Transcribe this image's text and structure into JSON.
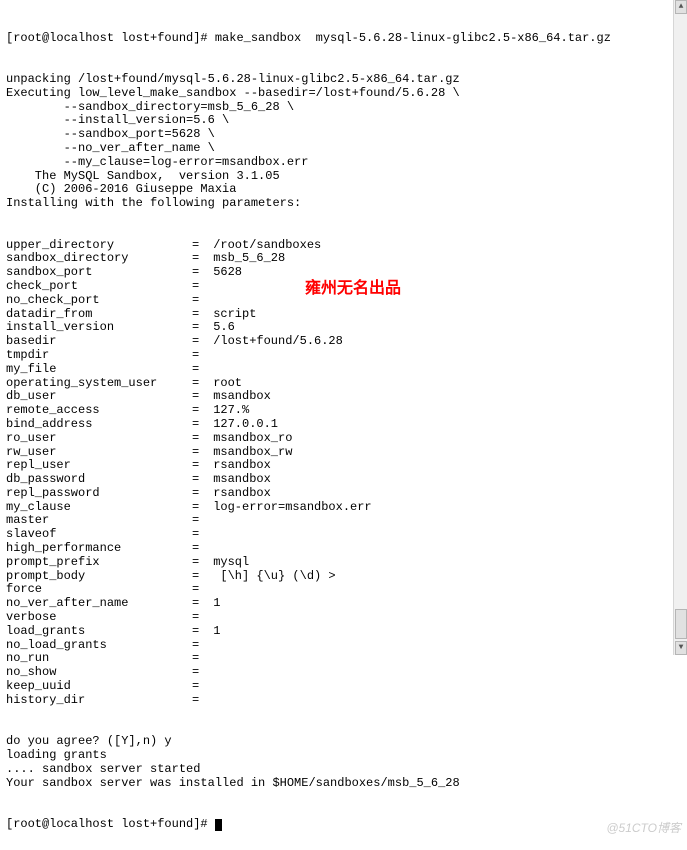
{
  "prompt1": "[root@localhost lost+found]# make_sandbox  mysql-5.6.28-linux-glibc2.5-x86_64.tar.gz",
  "header": [
    "unpacking /lost+found/mysql-5.6.28-linux-glibc2.5-x86_64.tar.gz",
    "Executing low_level_make_sandbox --basedir=/lost+found/5.6.28 \\",
    "        --sandbox_directory=msb_5_6_28 \\",
    "        --install_version=5.6 \\",
    "        --sandbox_port=5628 \\",
    "        --no_ver_after_name \\",
    "        --my_clause=log-error=msandbox.err",
    "    The MySQL Sandbox,  version 3.1.05",
    "    (C) 2006-2016 Giuseppe Maxia",
    "Installing with the following parameters:"
  ],
  "params": [
    {
      "k": "upper_directory",
      "v": "/root/sandboxes"
    },
    {
      "k": "sandbox_directory",
      "v": "msb_5_6_28"
    },
    {
      "k": "sandbox_port",
      "v": "5628"
    },
    {
      "k": "check_port",
      "v": ""
    },
    {
      "k": "no_check_port",
      "v": ""
    },
    {
      "k": "datadir_from",
      "v": "script"
    },
    {
      "k": "install_version",
      "v": "5.6"
    },
    {
      "k": "basedir",
      "v": "/lost+found/5.6.28"
    },
    {
      "k": "tmpdir",
      "v": ""
    },
    {
      "k": "my_file",
      "v": ""
    },
    {
      "k": "operating_system_user",
      "v": "root"
    },
    {
      "k": "db_user",
      "v": "msandbox"
    },
    {
      "k": "remote_access",
      "v": "127.%"
    },
    {
      "k": "bind_address",
      "v": "127.0.0.1"
    },
    {
      "k": "ro_user",
      "v": "msandbox_ro"
    },
    {
      "k": "rw_user",
      "v": "msandbox_rw"
    },
    {
      "k": "repl_user",
      "v": "rsandbox"
    },
    {
      "k": "db_password",
      "v": "msandbox"
    },
    {
      "k": "repl_password",
      "v": "rsandbox"
    },
    {
      "k": "my_clause",
      "v": "log-error=msandbox.err"
    },
    {
      "k": "master",
      "v": ""
    },
    {
      "k": "slaveof",
      "v": ""
    },
    {
      "k": "high_performance",
      "v": ""
    },
    {
      "k": "prompt_prefix",
      "v": "mysql"
    },
    {
      "k": "prompt_body",
      "v": " [\\h] {\\u} (\\d) >"
    },
    {
      "k": "force",
      "v": ""
    },
    {
      "k": "no_ver_after_name",
      "v": "1"
    },
    {
      "k": "verbose",
      "v": ""
    },
    {
      "k": "load_grants",
      "v": "1"
    },
    {
      "k": "no_load_grants",
      "v": ""
    },
    {
      "k": "no_run",
      "v": ""
    },
    {
      "k": "no_show",
      "v": ""
    },
    {
      "k": "keep_uuid",
      "v": ""
    },
    {
      "k": "history_dir",
      "v": ""
    }
  ],
  "footer": [
    "do you agree? ([Y],n) y",
    "loading grants",
    ".... sandbox server started",
    "Your sandbox server was installed in $HOME/sandboxes/msb_5_6_28"
  ],
  "prompt2": "[root@localhost lost+found]# ",
  "overlay": "雍州无名出品",
  "watermark": "@51CTO博客"
}
